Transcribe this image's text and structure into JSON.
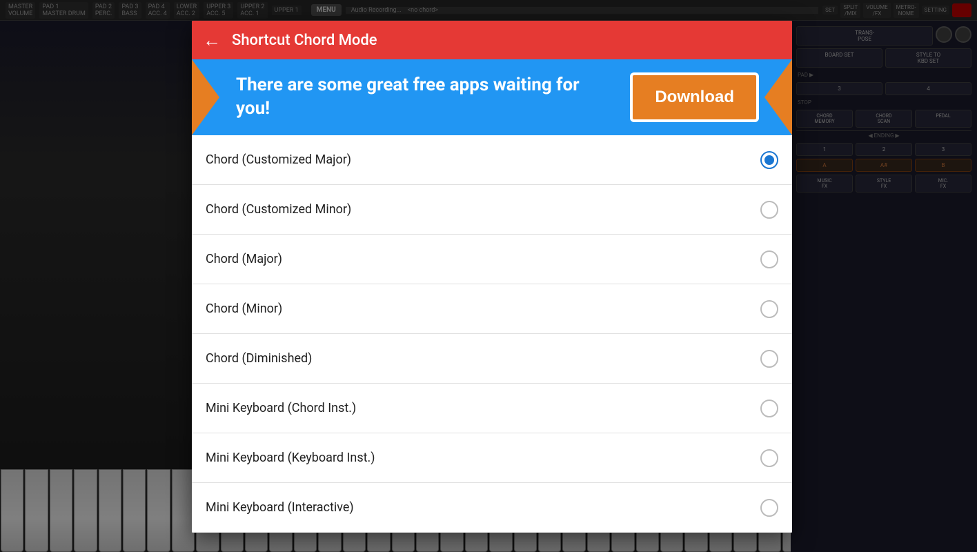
{
  "background": {
    "pads": [
      "PAD 1",
      "PAD 2",
      "PAD 3",
      "PAD 4"
    ],
    "pad_rows": [
      "MASTER DRUM",
      "LOWER PERC.",
      "UPPER 3 ACC. 2",
      "UPPER 2 ACC. 5",
      "ACC. 1"
    ],
    "menu_label": "MENU",
    "audio_label": "Audio Recording...",
    "chord_label": "<no chord>",
    "controls": [
      "SET",
      "SPLIT /MIX",
      "VOLUME /FX",
      "METRO- NOME",
      "SETTING"
    ]
  },
  "header": {
    "back_label": "←",
    "title": "Shortcut Chord Mode"
  },
  "ad_banner": {
    "text": "There are some great free apps waiting for you!",
    "download_label": "Download"
  },
  "radio_options": [
    {
      "id": "opt1",
      "label": "Chord (Customized Major)",
      "selected": true
    },
    {
      "id": "opt2",
      "label": "Chord (Customized Minor)",
      "selected": false
    },
    {
      "id": "opt3",
      "label": "Chord (Major)",
      "selected": false
    },
    {
      "id": "opt4",
      "label": "Chord (Minor)",
      "selected": false
    },
    {
      "id": "opt5",
      "label": "Chord (Diminished)",
      "selected": false
    },
    {
      "id": "opt6",
      "label": "Mini Keyboard (Chord Inst.)",
      "selected": false
    },
    {
      "id": "opt7",
      "label": "Mini Keyboard (Keyboard Inst.)",
      "selected": false
    },
    {
      "id": "opt8",
      "label": "Mini Keyboard (Interactive)",
      "selected": false
    }
  ],
  "right_panel": {
    "buttons_row1": [
      "TRANS- POSE",
      "",
      ""
    ],
    "buttons_row2": [
      "BOARD SET",
      "STYLE TO KBD SET"
    ],
    "chord_buttons": [
      "CHORD MEMORY",
      "CHORD SCAN",
      "PEDAL"
    ],
    "ending_label": "ENDING",
    "ending_nums": [
      "1",
      "2",
      "3"
    ],
    "kbd_keys": [
      "A",
      "A#",
      "B"
    ],
    "fx_labels": [
      "MUSIC FX",
      "STYLE FX",
      "MIC. FX"
    ]
  }
}
